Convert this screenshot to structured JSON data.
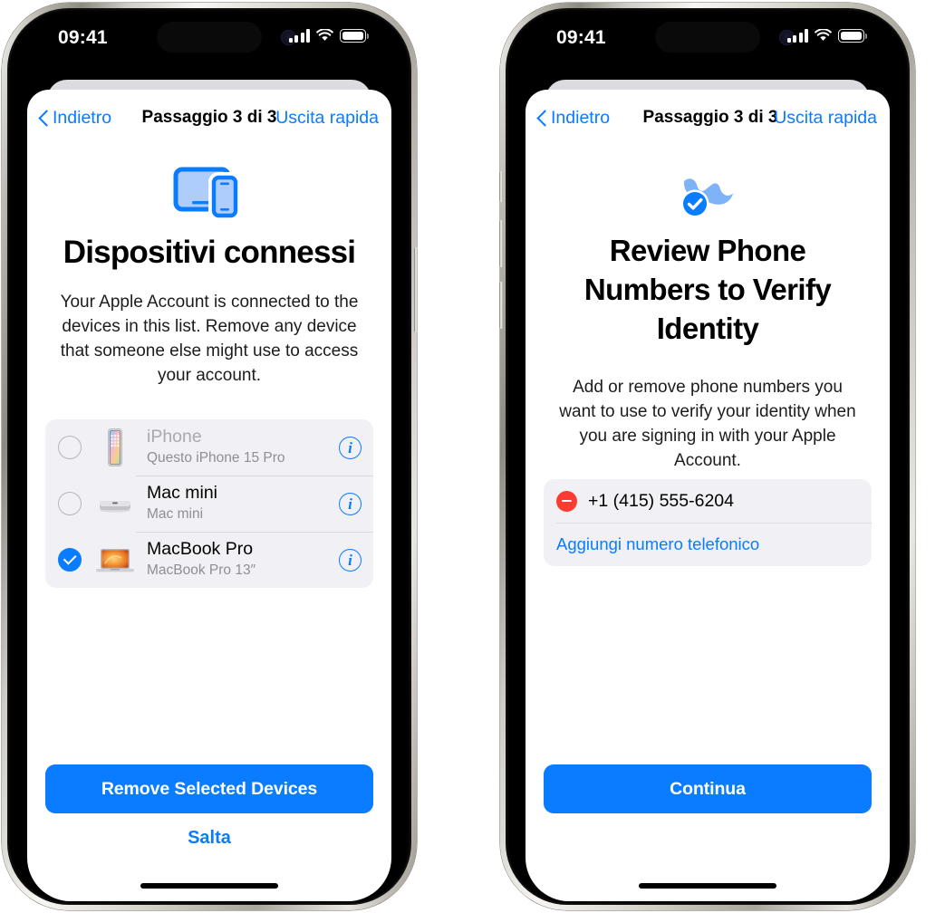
{
  "status_bar": {
    "time": "09:41",
    "signal_icon": "cellular-bars-icon",
    "wifi_icon": "wifi-icon",
    "battery_icon": "battery-full-icon"
  },
  "phone_left": {
    "nav": {
      "back_label": "Indietro",
      "title": "Passaggio 3 di 3",
      "right_label": "Uscita rapida",
      "back_icon": "chevron-left-icon"
    },
    "hero_icon": "devices-ipad-iphone-icon",
    "title": "Dispositivi connessi",
    "body": "Your Apple Account is connected to the devices in this list. Remove any device that someone else might use to access your account.",
    "devices": [
      {
        "name": "iPhone",
        "subtitle": "Questo iPhone 15 Pro",
        "selected": false,
        "dimmed": true,
        "thumb_icon": "iphone-thumbnail-icon",
        "info_label": "i"
      },
      {
        "name": "Mac mini",
        "subtitle": "Mac mini",
        "selected": false,
        "dimmed": false,
        "thumb_icon": "mac-mini-thumbnail-icon",
        "info_label": "i"
      },
      {
        "name": "MacBook Pro",
        "subtitle": "MacBook Pro 13″",
        "selected": true,
        "dimmed": false,
        "thumb_icon": "macbook-pro-thumbnail-icon",
        "info_label": "i"
      }
    ],
    "primary_button": "Remove Selected Devices",
    "secondary_link": "Salta"
  },
  "phone_right": {
    "nav": {
      "back_label": "Indietro",
      "title": "Passaggio 3 di 3",
      "right_label": "Uscita rapida",
      "back_icon": "chevron-left-icon"
    },
    "hero_icon": "phone-verified-checkmark-icon",
    "title": "Review Phone Numbers to Verify Identity",
    "body": "Add or remove phone numbers you want to use to verify your identity when you are signing in with your Apple Account.",
    "phone_numbers": [
      {
        "number": "+1 (415) 555-6204",
        "remove_icon": "minus-circle-icon"
      }
    ],
    "add_link": "Aggiungi numero telefonico",
    "primary_button": "Continua"
  },
  "colors": {
    "accent_blue": "#0a7cff",
    "destructive_red": "#fd3b30",
    "card_background": "#f1f1f5",
    "secondary_text": "#8e8e93"
  }
}
